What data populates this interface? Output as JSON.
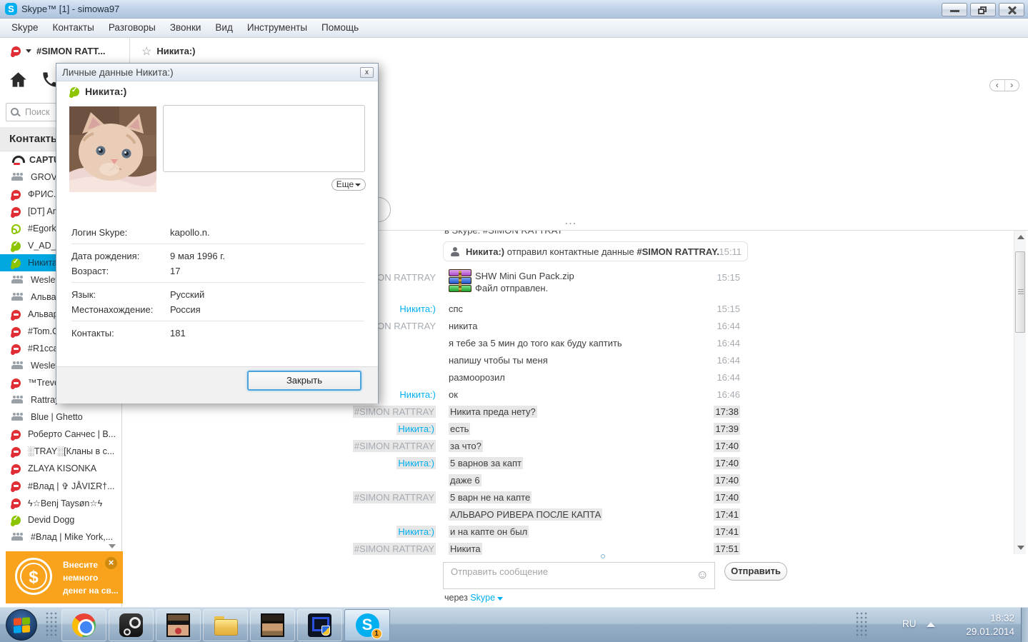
{
  "titlebar": {
    "title": "Skype™ [1] - simowa97"
  },
  "menu": [
    "Skype",
    "Контакты",
    "Разговоры",
    "Звонки",
    "Вид",
    "Инструменты",
    "Помощь"
  ],
  "tabs": [
    {
      "label": "#SIMON RATT...",
      "icon": "skype-dnd",
      "caret": true
    },
    {
      "label": "Никита:)",
      "icon": "star"
    }
  ],
  "sidebar": {
    "search_placeholder": "Поиск",
    "header": "Контакты",
    "contacts": [
      {
        "label": "CAPTU",
        "status": "capture",
        "bold": true
      },
      {
        "label": "GROVE",
        "status": "group"
      },
      {
        "label": "ФРИС.",
        "status": "dnd"
      },
      {
        "label": "[DT] An",
        "status": "dnd"
      },
      {
        "label": "#Egorka",
        "status": "hollow"
      },
      {
        "label": "V_AD_(",
        "status": "online"
      },
      {
        "label": "Никита",
        "status": "online",
        "selected": true
      },
      {
        "label": "Wesley",
        "status": "group"
      },
      {
        "label": "Альвар",
        "status": "group"
      },
      {
        "label": "Альвар",
        "status": "dnd"
      },
      {
        "label": "#Tom.C",
        "status": "dnd"
      },
      {
        "label": "#R1cca",
        "status": "dnd"
      },
      {
        "label": "Wesley",
        "status": "group"
      },
      {
        "label": "™Trevo",
        "status": "dnd"
      },
      {
        "label": "Rattray Conference...",
        "status": "group"
      },
      {
        "label": "Blue | Ghetto",
        "status": "group"
      },
      {
        "label": "Роберто Санчес | В...",
        "status": "dnd"
      },
      {
        "label": "░TRAY░[Кланы в с...",
        "status": "dnd"
      },
      {
        "label": "ZLAYA KISONKA",
        "status": "dnd"
      },
      {
        "label": "#Влад | ✞ JÅVIΣR†...",
        "status": "dnd"
      },
      {
        "label": "ϟ☆Benj Taysøn☆ϟ",
        "status": "dnd"
      },
      {
        "label": "Devid Dogg",
        "status": "online"
      },
      {
        "label": "#Влад | Mike York,...",
        "status": "group"
      }
    ],
    "ad": {
      "lines": [
        "Внесите",
        "немного",
        "денег на св..."
      ]
    }
  },
  "dialog": {
    "title": "Личные данные Никита:)",
    "name": "Никита:)",
    "more_button": "Еще",
    "field_groups": [
      [
        {
          "label": "Логин Skype:",
          "value": "kapollo.n."
        }
      ],
      [
        {
          "label": "Дата рождения:",
          "value": "9 мая 1996 г."
        },
        {
          "label": "Возраст:",
          "value": "17"
        }
      ],
      [
        {
          "label": "Язык:",
          "value": "Русский"
        },
        {
          "label": "Местонахождение:",
          "value": "Россия"
        }
      ],
      [
        {
          "label": "Контакты:",
          "value": "181"
        }
      ]
    ],
    "close_button": "Закрыть"
  },
  "chat": {
    "top_clipped": "в Skype: #SIMON RATTRAY",
    "notification": {
      "name": "Никита:)",
      "text": "отправил контактные данные",
      "target": "#SIMON RATTRAY.",
      "time": "15:11"
    },
    "file": {
      "sender": "#SIMON RATTRAY",
      "filename": "SHW Mini Gun Pack.zip",
      "status": "Файл отправлен.",
      "time": "15:15"
    },
    "messages": [
      {
        "sender": "Никита:)",
        "who": "me",
        "text": "спс",
        "time": "15:15"
      },
      {
        "sender": "#SIMON RATTRAY",
        "who": "them",
        "text": "никита",
        "time": "16:44"
      },
      {
        "sender": "",
        "text": "я тебе за 5 мин до того как буду каптить",
        "time": "16:44"
      },
      {
        "sender": "",
        "text": "напишу чтобы ты меня",
        "time": "16:44"
      },
      {
        "sender": "",
        "text": "размоорозил",
        "time": "16:44"
      },
      {
        "sender": "Никита:)",
        "who": "me",
        "text": "ок",
        "time": "16:46"
      },
      {
        "sender": "#SIMON RATTRAY",
        "who": "them",
        "text": "Никита преда нету?",
        "time": "17:38",
        "hl": true
      },
      {
        "sender": "Никита:)",
        "who": "me",
        "text": "есть",
        "time": "17:39",
        "hl": true
      },
      {
        "sender": "#SIMON RATTRAY",
        "who": "them",
        "text": "за что?",
        "time": "17:40",
        "hl": true
      },
      {
        "sender": "Никита:)",
        "who": "me",
        "text": "5 варнов за капт",
        "time": "17:40",
        "hl": true
      },
      {
        "sender": "",
        "text": "даже 6",
        "time": "17:40",
        "hl": true
      },
      {
        "sender": "#SIMON RATTRAY",
        "who": "them",
        "text": "5 варн не на капте",
        "time": "17:40",
        "hl": true
      },
      {
        "sender": "",
        "text": "АЛЬВАРО РИВЕРА ПОСЛЕ КАПТА",
        "time": "17:41",
        "hl": true
      },
      {
        "sender": "Никита:)",
        "who": "me",
        "text": "и на капте он был",
        "time": "17:41",
        "hl": true
      },
      {
        "sender": "#SIMON RATTRAY",
        "who": "them",
        "text": "Никита",
        "time": "17:51",
        "hl": true
      }
    ],
    "input_placeholder": "Отправить сообщение",
    "send_button": "Отправить",
    "via": {
      "prefix": "через",
      "link": "Skype"
    }
  },
  "taskbar": {
    "buttons": [
      {
        "name": "chrome"
      },
      {
        "name": "steam"
      },
      {
        "name": "photo1"
      },
      {
        "name": "folder"
      },
      {
        "name": "photo2"
      },
      {
        "name": "mta"
      },
      {
        "name": "skype",
        "active": true,
        "badge": "1"
      }
    ],
    "tray": {
      "lang": "RU",
      "time": "18:32",
      "date": "29.01.2014"
    }
  },
  "icons": {
    "star": "☆",
    "check": "✓",
    "smiley": "☺",
    "dollar": "$",
    "close_x": "×",
    "dialog_close_x": "x",
    "chevron_left": "‹",
    "chevron_right": "›",
    "exclaim": "!",
    "dots": "..."
  },
  "colors": {
    "accent_blue": "#00aff0",
    "status_red": "#e02d36",
    "status_green": "#8dc400",
    "selected_row": "#00a7e0",
    "ad_orange": "#f9a21b"
  }
}
